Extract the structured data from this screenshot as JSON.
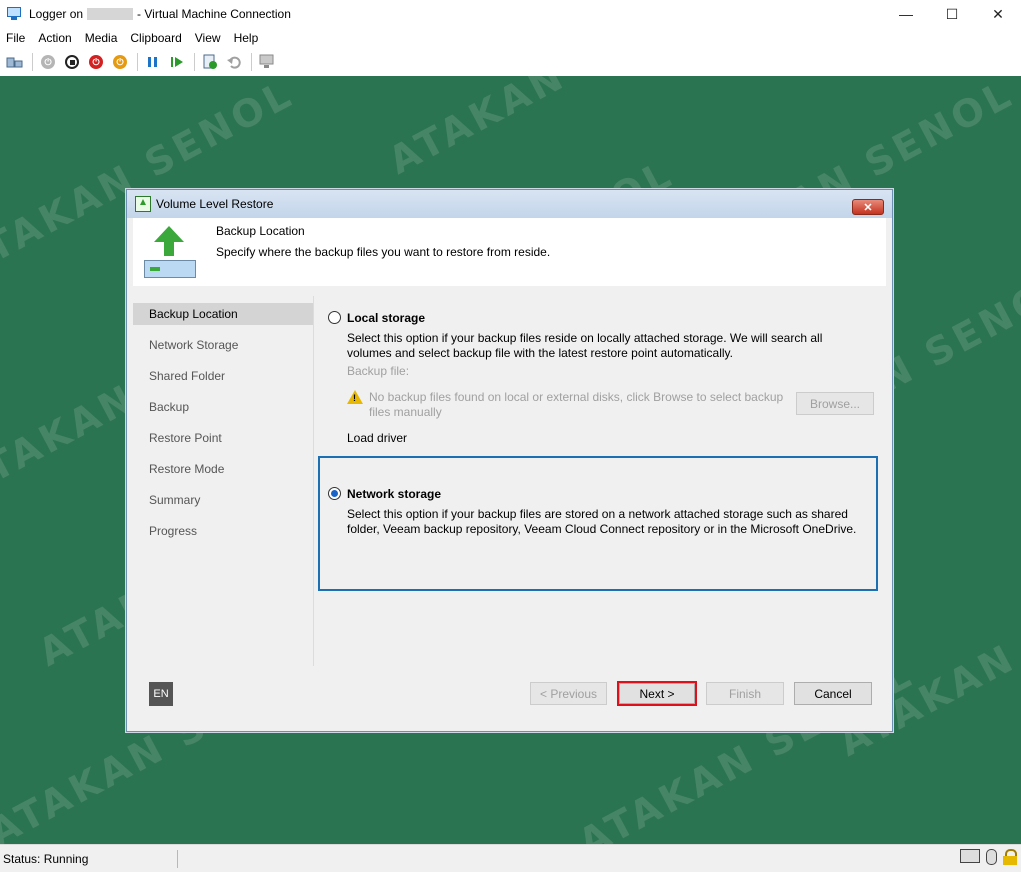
{
  "window": {
    "title_prefix": "Logger on",
    "title_suffix": "- Virtual Machine Connection",
    "minimize": "—",
    "maximize": "☐",
    "close": "✕"
  },
  "menu": [
    "File",
    "Action",
    "Media",
    "Clipboard",
    "View",
    "Help"
  ],
  "toolbar": {
    "icons": [
      "ctrl-alt-del-icon",
      "start-icon",
      "turn-off-icon",
      "shut-down-icon",
      "save-icon",
      "pause-icon",
      "reset-icon",
      "checkpoint-icon",
      "revert-icon",
      "enhanced-session-icon"
    ]
  },
  "watermark": "ATAKAN SENOL",
  "dialog": {
    "title": "Volume Level Restore",
    "close_glyph": "✕",
    "header_title": "Backup Location",
    "header_subtitle": "Specify where the backup files you want to restore from reside.",
    "steps": [
      "Backup Location",
      "Network Storage",
      "Shared Folder",
      "Backup",
      "Restore Point",
      "Restore Mode",
      "Summary",
      "Progress"
    ],
    "local": {
      "label": "Local storage",
      "description": "Select this option if your backup files reside on locally attached storage. We will search all volumes and select backup file with the latest restore point automatically.",
      "backup_file_label": "Backup file:",
      "warning": "No backup files found on local or external disks, click Browse to select backup files manually",
      "browse": "Browse...",
      "load_driver": "Load driver",
      "selected": false
    },
    "network": {
      "label": "Network storage",
      "description": "Select this option if your backup files are stored on a network attached storage such as shared folder, Veeam backup repository, Veeam Cloud Connect repository or in the Microsoft OneDrive.",
      "selected": true
    },
    "lang": "EN",
    "buttons": {
      "previous": "< Previous",
      "next": "Next >",
      "finish": "Finish",
      "cancel": "Cancel"
    }
  },
  "statusbar": {
    "status": "Status: Running"
  }
}
